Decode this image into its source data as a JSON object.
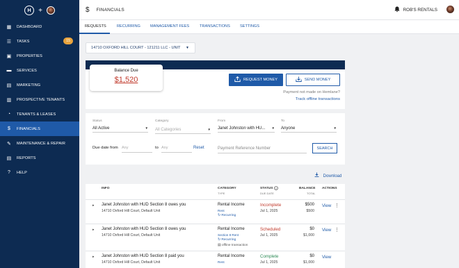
{
  "sidebar": {
    "items": [
      {
        "label": "DASHBOARD",
        "icon": "dashboard-icon",
        "glyph": "▦"
      },
      {
        "label": "TASKS",
        "icon": "tasks-icon",
        "glyph": "☰",
        "badge": "15"
      },
      {
        "label": "PROPERTIES",
        "icon": "properties-icon",
        "glyph": "▣"
      },
      {
        "label": "SERVICES",
        "icon": "services-icon",
        "glyph": "▬"
      },
      {
        "label": "MARKETING",
        "icon": "marketing-icon",
        "glyph": "▤"
      },
      {
        "label": "PROSPECTIVE TENANTS",
        "icon": "prospective-tenants-icon",
        "glyph": "▥"
      },
      {
        "label": "TENANTS & LEASES",
        "icon": "tenants-icon",
        "glyph": "◔"
      },
      {
        "label": "FINANCIALS",
        "icon": "financials-icon",
        "glyph": "$"
      },
      {
        "label": "MAINTENANCE & REPAIR",
        "icon": "wrench-icon",
        "glyph": "✎"
      },
      {
        "label": "REPORTS",
        "icon": "reports-icon",
        "glyph": "▤"
      },
      {
        "label": "HELP",
        "icon": "help-icon",
        "glyph": "?"
      }
    ]
  },
  "header": {
    "title": "FINANCIALS",
    "account": "ROB'S RENTALS"
  },
  "tabs": [
    "REQUESTS",
    "RECURRING",
    "MANAGEMENT FEES",
    "TRANSACTIONS",
    "SETTINGS"
  ],
  "property_select": "14710 OXFORD HILL COURT - 121211 LLC - UNIT",
  "balance": {
    "label": "Balance Due",
    "value": "$1,520"
  },
  "actions": {
    "request": "REQUEST MONEY",
    "send": "SEND MONEY",
    "not_made": "Payment not made on Hemlane?",
    "track": "Track offline transactions"
  },
  "filters": {
    "status_label": "Status",
    "status_value": "All Active",
    "category_label": "Category",
    "category_placeholder": "All Categories",
    "from_label": "From",
    "from_value": "Janet Johnston with HU...",
    "to_label": "To",
    "to_value": "Anyone",
    "due_label": "Due date from",
    "date_placeholder": "Any",
    "to_word": "to",
    "reset": "Reset",
    "ref_placeholder": "Payment Reference Number",
    "search": "SEARCH"
  },
  "download": "Download",
  "table": {
    "headers": {
      "info": "INFO",
      "category": "CATEGORY",
      "category_sub": "TYPE",
      "status": "STATUS",
      "status_sub": "DUE DATE",
      "balance": "BALANCE",
      "balance_sub": "TOTAL",
      "actions": "ACTIONS"
    },
    "rows": [
      {
        "title": "Janet Johnston with HUD Section 8 owes you",
        "address": "14710 Oxford Hill Court, Default Unit",
        "category": "Rental Income",
        "type": "Rent",
        "tag": "Recurring",
        "offline": "",
        "status": "Incomplete",
        "status_color": "#c0392b",
        "due": "Jul 1, 2025",
        "balance": "$500",
        "total": "$500",
        "view": "View"
      },
      {
        "title": "Janet Johnston with HUD Section 8 owes you",
        "address": "14710 Oxford Hill Court, Default Unit",
        "category": "Rental Income",
        "type": "Section 8 Rent",
        "tag": "Recurring",
        "offline": "offline transaction",
        "status": "Scheduled",
        "status_color": "#c0392b",
        "due": "Jul 1, 2025",
        "balance": "$0",
        "total": "$1,000",
        "view": "View"
      },
      {
        "title": "Janet Johnston with HUD Section 8 paid you",
        "address": "14710 Oxford Hill Court, Default Unit",
        "category": "Rental Income",
        "type": "Rent",
        "tag": "",
        "offline": "",
        "status": "Complete",
        "status_color": "#2e8b57",
        "due": "Jul 1, 2025",
        "balance": "$0",
        "total": "$1,000",
        "view": "View"
      }
    ]
  }
}
